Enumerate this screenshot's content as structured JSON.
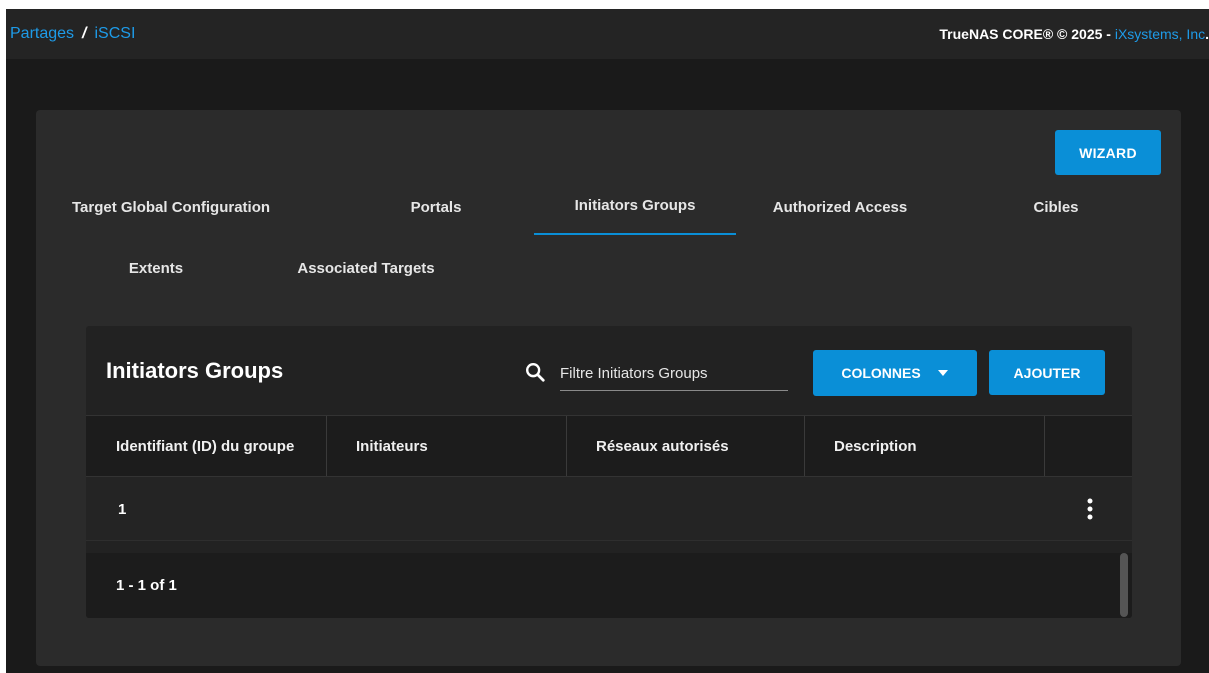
{
  "breadcrumb": {
    "root": "Partages",
    "separator": "/",
    "current": "iSCSI"
  },
  "copyright": {
    "text": "TrueNAS CORE® © 2025 - ",
    "company": "iXsystems, Inc",
    "end": "."
  },
  "wizard_label": "WIZARD",
  "tabs": [
    {
      "label": "Target Global Configuration"
    },
    {
      "label": "Portals"
    },
    {
      "label": "Initiators Groups"
    },
    {
      "label": "Authorized Access"
    },
    {
      "label": "Cibles"
    },
    {
      "label": "Extents"
    },
    {
      "label": "Associated Targets"
    }
  ],
  "active_tab": "Initiators Groups",
  "panel": {
    "title": "Initiators Groups",
    "search_placeholder": "Filtre Initiators Groups",
    "columns_button": "COLONNES",
    "add_button": "AJOUTER"
  },
  "table": {
    "headers": [
      "Identifiant (ID) du groupe",
      "Initiateurs",
      "Réseaux autorisés",
      "Description"
    ],
    "rows": [
      {
        "id": "1",
        "initiators": "",
        "networks": "",
        "description": ""
      }
    ],
    "pagination": "1 - 1 of 1"
  },
  "colors": {
    "accent": "#0a8fd7",
    "link": "#1e9be8",
    "background": "#1a1a1a"
  },
  "icons": {
    "search": "search-icon",
    "dropdown": "caret-down-icon",
    "row_menu": "kebab-menu-icon"
  }
}
